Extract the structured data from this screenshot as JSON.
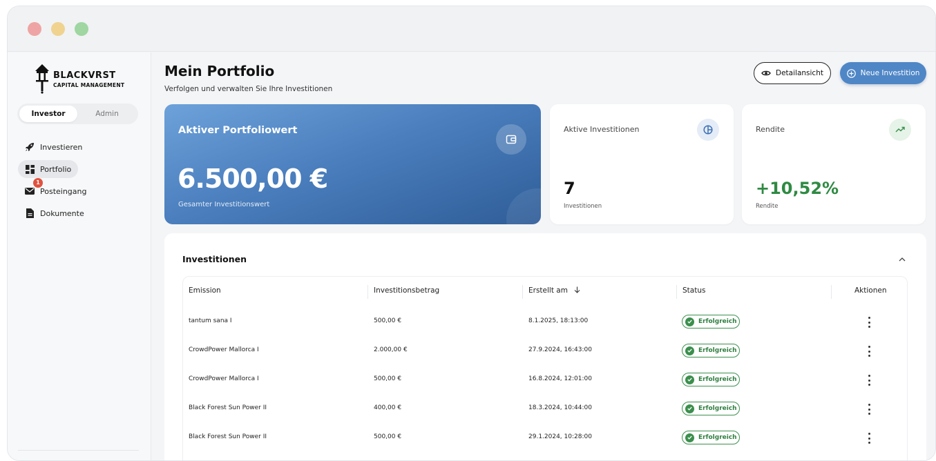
{
  "sidebar": {
    "logo": {
      "title": "BLACKVRST",
      "subtitle": "CAPITAL MANAGEMENT"
    },
    "roles": {
      "investor": "Investor",
      "admin": "Admin"
    },
    "nav": [
      {
        "label": "Investieren",
        "icon": "rocket-icon"
      },
      {
        "label": "Portfolio",
        "icon": "dashboard-icon"
      },
      {
        "label": "Posteingang",
        "icon": "mail-icon",
        "badge": "1"
      },
      {
        "label": "Dokumente",
        "icon": "document-icon"
      }
    ]
  },
  "header": {
    "title": "Mein Portfolio",
    "subtitle": "Verfolgen und verwalten Sie Ihre Investitionen",
    "detail_label": "Detailansicht",
    "new_label": "Neue Investition"
  },
  "hero": {
    "title": "Aktiver Portfoliowert",
    "value": "6.500,00 €",
    "caption": "Gesamter Investitionswert"
  },
  "stats": {
    "active": {
      "label": "Aktive Investitionen",
      "value": "7",
      "caption": "Investitionen"
    },
    "rendite": {
      "label": "Rendite",
      "value": "+10,52%",
      "caption": "Rendite"
    }
  },
  "investments": {
    "title": "Investitionen",
    "columns": {
      "emission": "Emission",
      "amount": "Investitionsbetrag",
      "created": "Erstellt am",
      "status": "Status",
      "actions": "Aktionen"
    },
    "rows": [
      {
        "emission": "tantum sana I",
        "amount": "500,00 €",
        "created": "8.1.2025, 18:13:00",
        "status": "Erfolgreich"
      },
      {
        "emission": "CrowdPower Mallorca I",
        "amount": "2.000,00 €",
        "created": "27.9.2024, 16:43:00",
        "status": "Erfolgreich"
      },
      {
        "emission": "CrowdPower Mallorca I",
        "amount": "500,00 €",
        "created": "16.8.2024, 12:01:00",
        "status": "Erfolgreich"
      },
      {
        "emission": "Black Forest Sun Power II",
        "amount": "400,00 €",
        "created": "18.3.2024, 10:44:00",
        "status": "Erfolgreich"
      },
      {
        "emission": "Black Forest Sun Power II",
        "amount": "500,00 €",
        "created": "29.1.2024, 10:28:00",
        "status": "Erfolgreich"
      }
    ]
  },
  "colors": {
    "accent": "#4f86c6",
    "success": "#2f8a43",
    "badge": "#e0533f"
  }
}
